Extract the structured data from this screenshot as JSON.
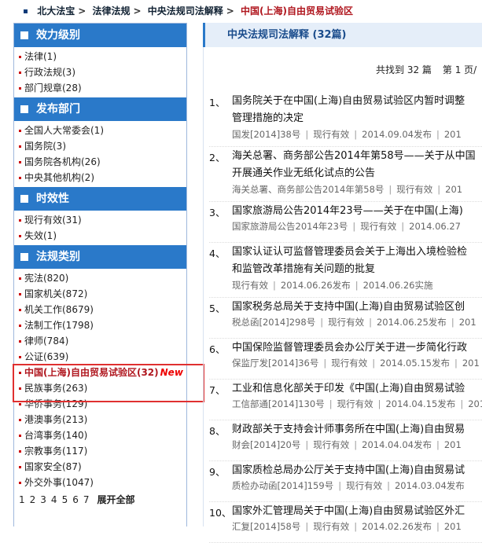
{
  "breadcrumb": {
    "items": [
      "北大法宝",
      "法律法规",
      "中央法规司法解释"
    ],
    "current": "中国(上海)自由贸易试验区",
    "separator": ">"
  },
  "sidebar": {
    "sections": [
      {
        "title": "效力级别",
        "items": [
          "法律(1)",
          "行政法规(3)",
          "部门规章(28)"
        ]
      },
      {
        "title": "发布部门",
        "items": [
          "全国人大常委会(1)",
          "国务院(3)",
          "国务院各机构(26)",
          "中央其他机构(2)"
        ]
      },
      {
        "title": "时效性",
        "items": [
          "现行有效(31)",
          "失效(1)"
        ]
      },
      {
        "title": "法规类别",
        "items": [
          "宪法(820)",
          "国家机关(872)",
          "机关工作(8679)",
          "法制工作(1798)",
          "律师(784)",
          "公证(639)",
          "中国(上海)自由贸易试验区(32)",
          "民族事务(263)",
          "华侨事务(129)",
          "港澳事务(213)",
          "台湾事务(140)",
          "宗教事务(117)",
          "国家安全(87)",
          "外交外事(1047)"
        ]
      }
    ],
    "new_label": "New",
    "pager": {
      "pages": [
        "1",
        "2",
        "3",
        "4",
        "5",
        "6",
        "7"
      ],
      "expand": "展开全部"
    }
  },
  "main": {
    "header": "中央法规司法解释 (32篇)",
    "found": "共找到 32 篇",
    "page": "第 1 页/"
  },
  "results": [
    {
      "num": "1、",
      "title1": "国务院关于在中国(上海)自由贸易试验区内暂时调整",
      "title2": "管理措施的决定",
      "doc": "国发[2014]38号",
      "status": "现行有效",
      "date": "2014.09.04发布",
      "extra": "201"
    },
    {
      "num": "2、",
      "title1": "海关总署、商务部公告2014年第58号——关于从中国",
      "title2": "开展通关作业无纸化试点的公告",
      "doc": "海关总署、商务部公告2014年第58号",
      "status": "现行有效",
      "date": "",
      "extra": "201"
    },
    {
      "num": "3、",
      "title1": "国家旅游局公告2014年23号——关于在中国(上海)",
      "title2": "",
      "doc": "国家旅游局公告2014年23号",
      "status": "现行有效",
      "date": "2014.06.27",
      "extra": ""
    },
    {
      "num": "4、",
      "title1": "国家认证认可监督管理委员会关于上海出入境检验检",
      "title2": "和监管改革措施有关问题的批复",
      "doc": "现行有效",
      "status": "",
      "date": "2014.06.26发布",
      "extra": "2014.06.26实施"
    },
    {
      "num": "5、",
      "title1": "国家税务总局关于支持中国(上海)自由贸易试验区创",
      "title2": "",
      "doc": "税总函[2014]298号",
      "status": "现行有效",
      "date": "2014.06.25发布",
      "extra": "201"
    },
    {
      "num": "6、",
      "title1": "中国保险监督管理委员会办公厅关于进一步简化行政",
      "title2": "",
      "doc": "保监厅发[2014]36号",
      "status": "现行有效",
      "date": "2014.05.15发布",
      "extra": "201"
    },
    {
      "num": "7、",
      "title1": "工业和信息化部关于印发《中国(上海)自由贸易试验",
      "title2": "",
      "doc": "工信部通[2014]130号",
      "status": "现行有效",
      "date": "2014.04.15发布",
      "extra": "201"
    },
    {
      "num": "8、",
      "title1": "财政部关于支持会计师事务所在中国(上海)自由贸易",
      "title2": "",
      "doc": "财会[2014]20号",
      "status": "现行有效",
      "date": "2014.04.04发布",
      "extra": "201"
    },
    {
      "num": "9、",
      "title1": "国家质检总局办公厅关于支持中国(上海)自由贸易试",
      "title2": "",
      "doc": "质检办动函[2014]159号",
      "status": "现行有效",
      "date": "2014.03.04发布",
      "extra": ""
    },
    {
      "num": "10、",
      "title1": "国家外汇管理局关于中国(上海)自由贸易试验区外汇",
      "title2": "",
      "doc": "汇复[2014]58号",
      "status": "现行有效",
      "date": "2014.02.26发布",
      "extra": "201"
    }
  ]
}
